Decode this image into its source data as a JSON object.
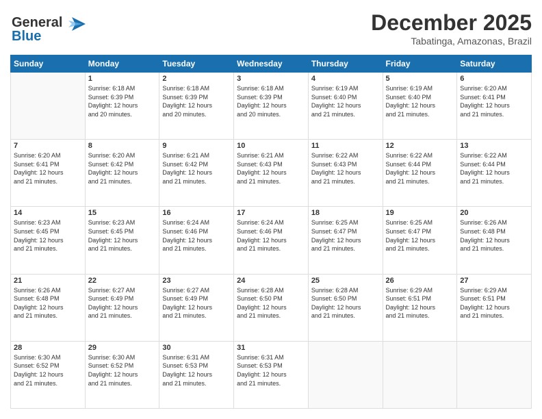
{
  "logo": {
    "line1": "General",
    "line2": "Blue"
  },
  "title": "December 2025",
  "subtitle": "Tabatinga, Amazonas, Brazil",
  "headers": [
    "Sunday",
    "Monday",
    "Tuesday",
    "Wednesday",
    "Thursday",
    "Friday",
    "Saturday"
  ],
  "weeks": [
    [
      {
        "day": "",
        "info": ""
      },
      {
        "day": "1",
        "info": "Sunrise: 6:18 AM\nSunset: 6:39 PM\nDaylight: 12 hours\nand 20 minutes."
      },
      {
        "day": "2",
        "info": "Sunrise: 6:18 AM\nSunset: 6:39 PM\nDaylight: 12 hours\nand 20 minutes."
      },
      {
        "day": "3",
        "info": "Sunrise: 6:18 AM\nSunset: 6:39 PM\nDaylight: 12 hours\nand 20 minutes."
      },
      {
        "day": "4",
        "info": "Sunrise: 6:19 AM\nSunset: 6:40 PM\nDaylight: 12 hours\nand 21 minutes."
      },
      {
        "day": "5",
        "info": "Sunrise: 6:19 AM\nSunset: 6:40 PM\nDaylight: 12 hours\nand 21 minutes."
      },
      {
        "day": "6",
        "info": "Sunrise: 6:20 AM\nSunset: 6:41 PM\nDaylight: 12 hours\nand 21 minutes."
      }
    ],
    [
      {
        "day": "7",
        "info": "Sunrise: 6:20 AM\nSunset: 6:41 PM\nDaylight: 12 hours\nand 21 minutes."
      },
      {
        "day": "8",
        "info": "Sunrise: 6:20 AM\nSunset: 6:42 PM\nDaylight: 12 hours\nand 21 minutes."
      },
      {
        "day": "9",
        "info": "Sunrise: 6:21 AM\nSunset: 6:42 PM\nDaylight: 12 hours\nand 21 minutes."
      },
      {
        "day": "10",
        "info": "Sunrise: 6:21 AM\nSunset: 6:43 PM\nDaylight: 12 hours\nand 21 minutes."
      },
      {
        "day": "11",
        "info": "Sunrise: 6:22 AM\nSunset: 6:43 PM\nDaylight: 12 hours\nand 21 minutes."
      },
      {
        "day": "12",
        "info": "Sunrise: 6:22 AM\nSunset: 6:44 PM\nDaylight: 12 hours\nand 21 minutes."
      },
      {
        "day": "13",
        "info": "Sunrise: 6:22 AM\nSunset: 6:44 PM\nDaylight: 12 hours\nand 21 minutes."
      }
    ],
    [
      {
        "day": "14",
        "info": "Sunrise: 6:23 AM\nSunset: 6:45 PM\nDaylight: 12 hours\nand 21 minutes."
      },
      {
        "day": "15",
        "info": "Sunrise: 6:23 AM\nSunset: 6:45 PM\nDaylight: 12 hours\nand 21 minutes."
      },
      {
        "day": "16",
        "info": "Sunrise: 6:24 AM\nSunset: 6:46 PM\nDaylight: 12 hours\nand 21 minutes."
      },
      {
        "day": "17",
        "info": "Sunrise: 6:24 AM\nSunset: 6:46 PM\nDaylight: 12 hours\nand 21 minutes."
      },
      {
        "day": "18",
        "info": "Sunrise: 6:25 AM\nSunset: 6:47 PM\nDaylight: 12 hours\nand 21 minutes."
      },
      {
        "day": "19",
        "info": "Sunrise: 6:25 AM\nSunset: 6:47 PM\nDaylight: 12 hours\nand 21 minutes."
      },
      {
        "day": "20",
        "info": "Sunrise: 6:26 AM\nSunset: 6:48 PM\nDaylight: 12 hours\nand 21 minutes."
      }
    ],
    [
      {
        "day": "21",
        "info": "Sunrise: 6:26 AM\nSunset: 6:48 PM\nDaylight: 12 hours\nand 21 minutes."
      },
      {
        "day": "22",
        "info": "Sunrise: 6:27 AM\nSunset: 6:49 PM\nDaylight: 12 hours\nand 21 minutes."
      },
      {
        "day": "23",
        "info": "Sunrise: 6:27 AM\nSunset: 6:49 PM\nDaylight: 12 hours\nand 21 minutes."
      },
      {
        "day": "24",
        "info": "Sunrise: 6:28 AM\nSunset: 6:50 PM\nDaylight: 12 hours\nand 21 minutes."
      },
      {
        "day": "25",
        "info": "Sunrise: 6:28 AM\nSunset: 6:50 PM\nDaylight: 12 hours\nand 21 minutes."
      },
      {
        "day": "26",
        "info": "Sunrise: 6:29 AM\nSunset: 6:51 PM\nDaylight: 12 hours\nand 21 minutes."
      },
      {
        "day": "27",
        "info": "Sunrise: 6:29 AM\nSunset: 6:51 PM\nDaylight: 12 hours\nand 21 minutes."
      }
    ],
    [
      {
        "day": "28",
        "info": "Sunrise: 6:30 AM\nSunset: 6:52 PM\nDaylight: 12 hours\nand 21 minutes."
      },
      {
        "day": "29",
        "info": "Sunrise: 6:30 AM\nSunset: 6:52 PM\nDaylight: 12 hours\nand 21 minutes."
      },
      {
        "day": "30",
        "info": "Sunrise: 6:31 AM\nSunset: 6:53 PM\nDaylight: 12 hours\nand 21 minutes."
      },
      {
        "day": "31",
        "info": "Sunrise: 6:31 AM\nSunset: 6:53 PM\nDaylight: 12 hours\nand 21 minutes."
      },
      {
        "day": "",
        "info": ""
      },
      {
        "day": "",
        "info": ""
      },
      {
        "day": "",
        "info": ""
      }
    ]
  ]
}
